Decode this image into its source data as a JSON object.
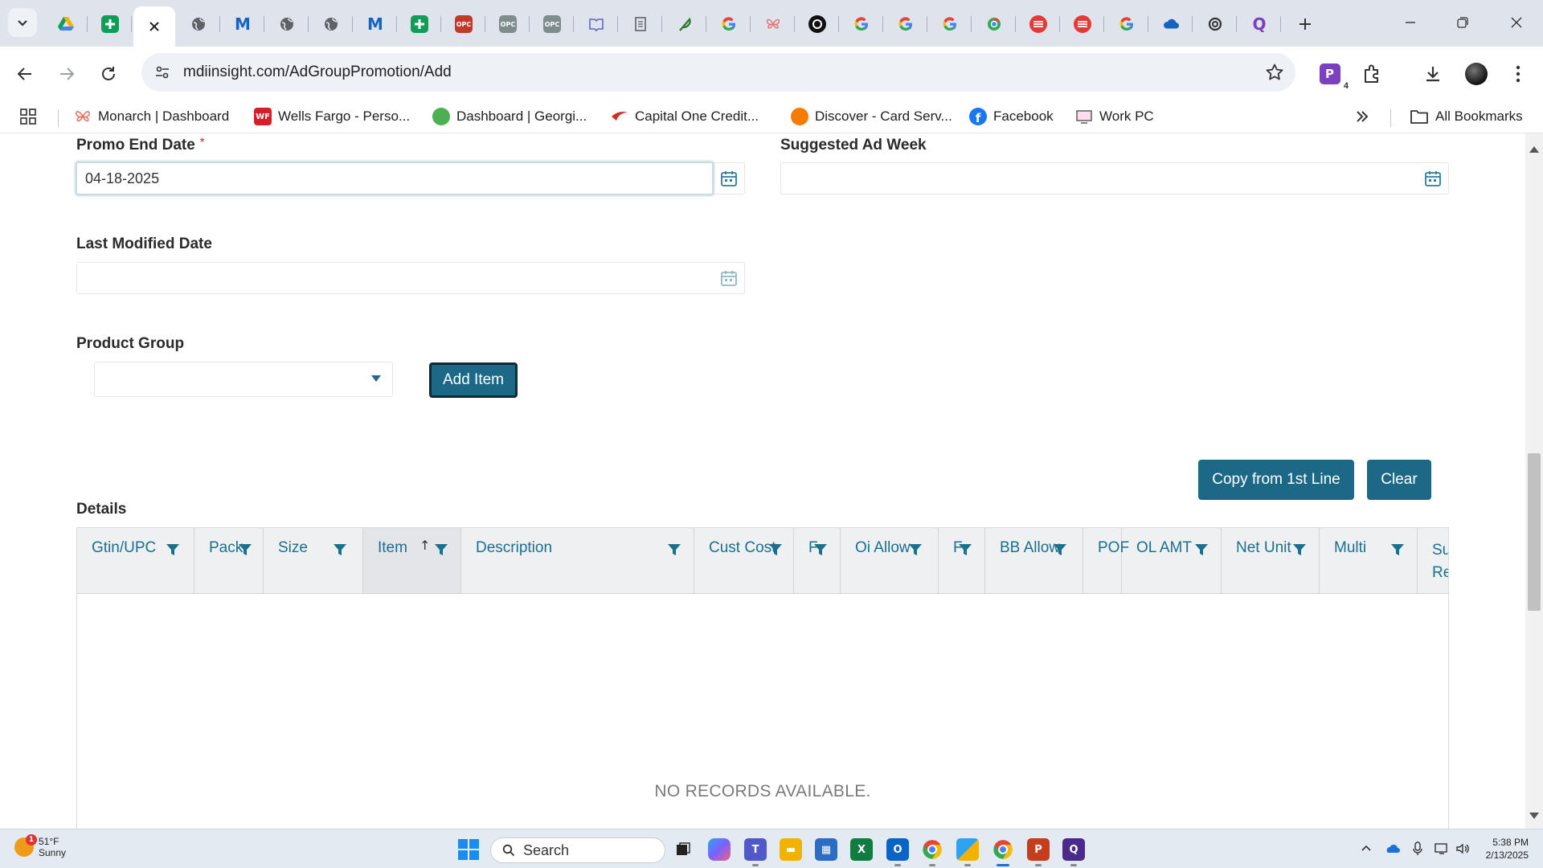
{
  "browser": {
    "tabs": [
      {
        "icon": "google-drive-icon",
        "color": "#f4b400"
      },
      {
        "icon": "google-sheets-icon",
        "color": "#0f9d58"
      },
      {
        "icon": "close-icon",
        "color": "#333333",
        "active": true
      },
      {
        "icon": "globe-icon",
        "color": "#5f6368"
      },
      {
        "icon": "monarch-m-icon",
        "color": "#1565c0"
      },
      {
        "icon": "globe-icon",
        "color": "#5f6368"
      },
      {
        "icon": "globe-icon",
        "color": "#5f6368"
      },
      {
        "icon": "monarch-m-icon",
        "color": "#1565c0"
      },
      {
        "icon": "google-sheets-icon",
        "color": "#0f9d58"
      },
      {
        "icon": "opc-icon",
        "color": "#c0392b"
      },
      {
        "icon": "opc-icon",
        "color": "#7f8c8d"
      },
      {
        "icon": "opc-icon",
        "color": "#7f8c8d"
      },
      {
        "icon": "book-icon",
        "color": "#5c6bc0"
      },
      {
        "icon": "page-icon",
        "color": "#5f6368"
      },
      {
        "icon": "feather-icon",
        "color": "#2e7d32"
      },
      {
        "icon": "google-icon",
        "color": "#4285f4"
      },
      {
        "icon": "butterfly-icon",
        "color": "#e57373"
      },
      {
        "icon": "circle-app-icon",
        "color": "#111111"
      },
      {
        "icon": "google-icon",
        "color": "#4285f4"
      },
      {
        "icon": "google-icon",
        "color": "#4285f4"
      },
      {
        "icon": "google-icon",
        "color": "#4285f4"
      },
      {
        "icon": "chrome-store-icon",
        "color": "#34a853"
      },
      {
        "icon": "red-stack-icon",
        "color": "#e53935"
      },
      {
        "icon": "red-stack-icon",
        "color": "#e53935"
      },
      {
        "icon": "google-icon",
        "color": "#4285f4"
      },
      {
        "icon": "cloud-icon",
        "color": "#1565c0"
      },
      {
        "icon": "openai-icon",
        "color": "#333333"
      },
      {
        "icon": "qualtrics-icon",
        "color": "#7b3fbf"
      }
    ],
    "url": "mdiinsight.com/AdGroupPromotion/Add",
    "extension_badge": "4",
    "bookmarks": [
      {
        "label": "Monarch | Dashboard",
        "icon": "monarch-butterfly-icon",
        "color": "#e57368"
      },
      {
        "label": "Wells Fargo - Perso...",
        "icon": "wells-fargo-icon",
        "color": "#d71e28",
        "abbr": "WF"
      },
      {
        "label": "Dashboard | Georgi...",
        "icon": "georgia-icon",
        "color": "#4caf50"
      },
      {
        "label": "Capital One Credit...",
        "icon": "capital-one-icon",
        "color": "#d22e1e"
      },
      {
        "label": "Discover - Card Serv...",
        "icon": "discover-icon",
        "color": "#f57c00"
      },
      {
        "label": "Facebook",
        "icon": "facebook-icon",
        "color": "#1877f2"
      },
      {
        "label": "Work PC",
        "icon": "work-pc-icon",
        "color": "#777777"
      }
    ],
    "all_bookmarks_label": "All Bookmarks"
  },
  "form": {
    "promo_end_date_label": "Promo End Date",
    "promo_end_date_required": "*",
    "promo_end_date_value": "04-18-2025",
    "suggested_ad_week_label": "Suggested Ad Week",
    "suggested_ad_week_value": "",
    "last_modified_date_label": "Last Modified Date",
    "last_modified_date_value": "",
    "product_group_label": "Product Group",
    "product_group_value": "",
    "add_item_label": "Add Item",
    "copy_first_line_label": "Copy from 1st Line",
    "clear_label": "Clear"
  },
  "details": {
    "title": "Details",
    "columns": [
      "Gtin/UPC",
      "Pack",
      "Size",
      "Item",
      "Description",
      "Cust Cost",
      "F",
      "Oi Allow",
      "F",
      "BB Allow",
      "POF",
      "OL AMT",
      "Net Unit",
      "Multi",
      "Su Re"
    ],
    "sorted_column": "Item",
    "sort_direction_glyph": "↑",
    "empty_message": "NO RECORDS AVAILABLE."
  },
  "taskbar": {
    "weather_temp": "51°F",
    "weather_desc": "Sunny",
    "weather_badge": "1",
    "search_label": "Search",
    "time": "5:38 PM",
    "date": "2/13/2025",
    "apps": [
      {
        "icon": "task-view-icon",
        "color": "#222222"
      },
      {
        "icon": "copilot-icon",
        "color": "#7b61ff"
      },
      {
        "icon": "teams-icon",
        "color": "#5059c9"
      },
      {
        "icon": "file-explorer-icon",
        "color": "#f2b200"
      },
      {
        "icon": "microsoft-store-icon",
        "color": "#2b6cc4"
      },
      {
        "icon": "excel-icon",
        "color": "#107c41"
      },
      {
        "icon": "outlook-icon",
        "color": "#0a64c8"
      },
      {
        "icon": "chrome-icon",
        "color": "#e8453c"
      },
      {
        "icon": "snip-tool-icon",
        "color": "#d9534f"
      },
      {
        "icon": "chrome-icon",
        "color": "#e8453c"
      },
      {
        "icon": "powerpoint-icon",
        "color": "#c43e1c"
      },
      {
        "icon": "qualtrics-icon",
        "color": "#4a2a8a"
      }
    ]
  }
}
